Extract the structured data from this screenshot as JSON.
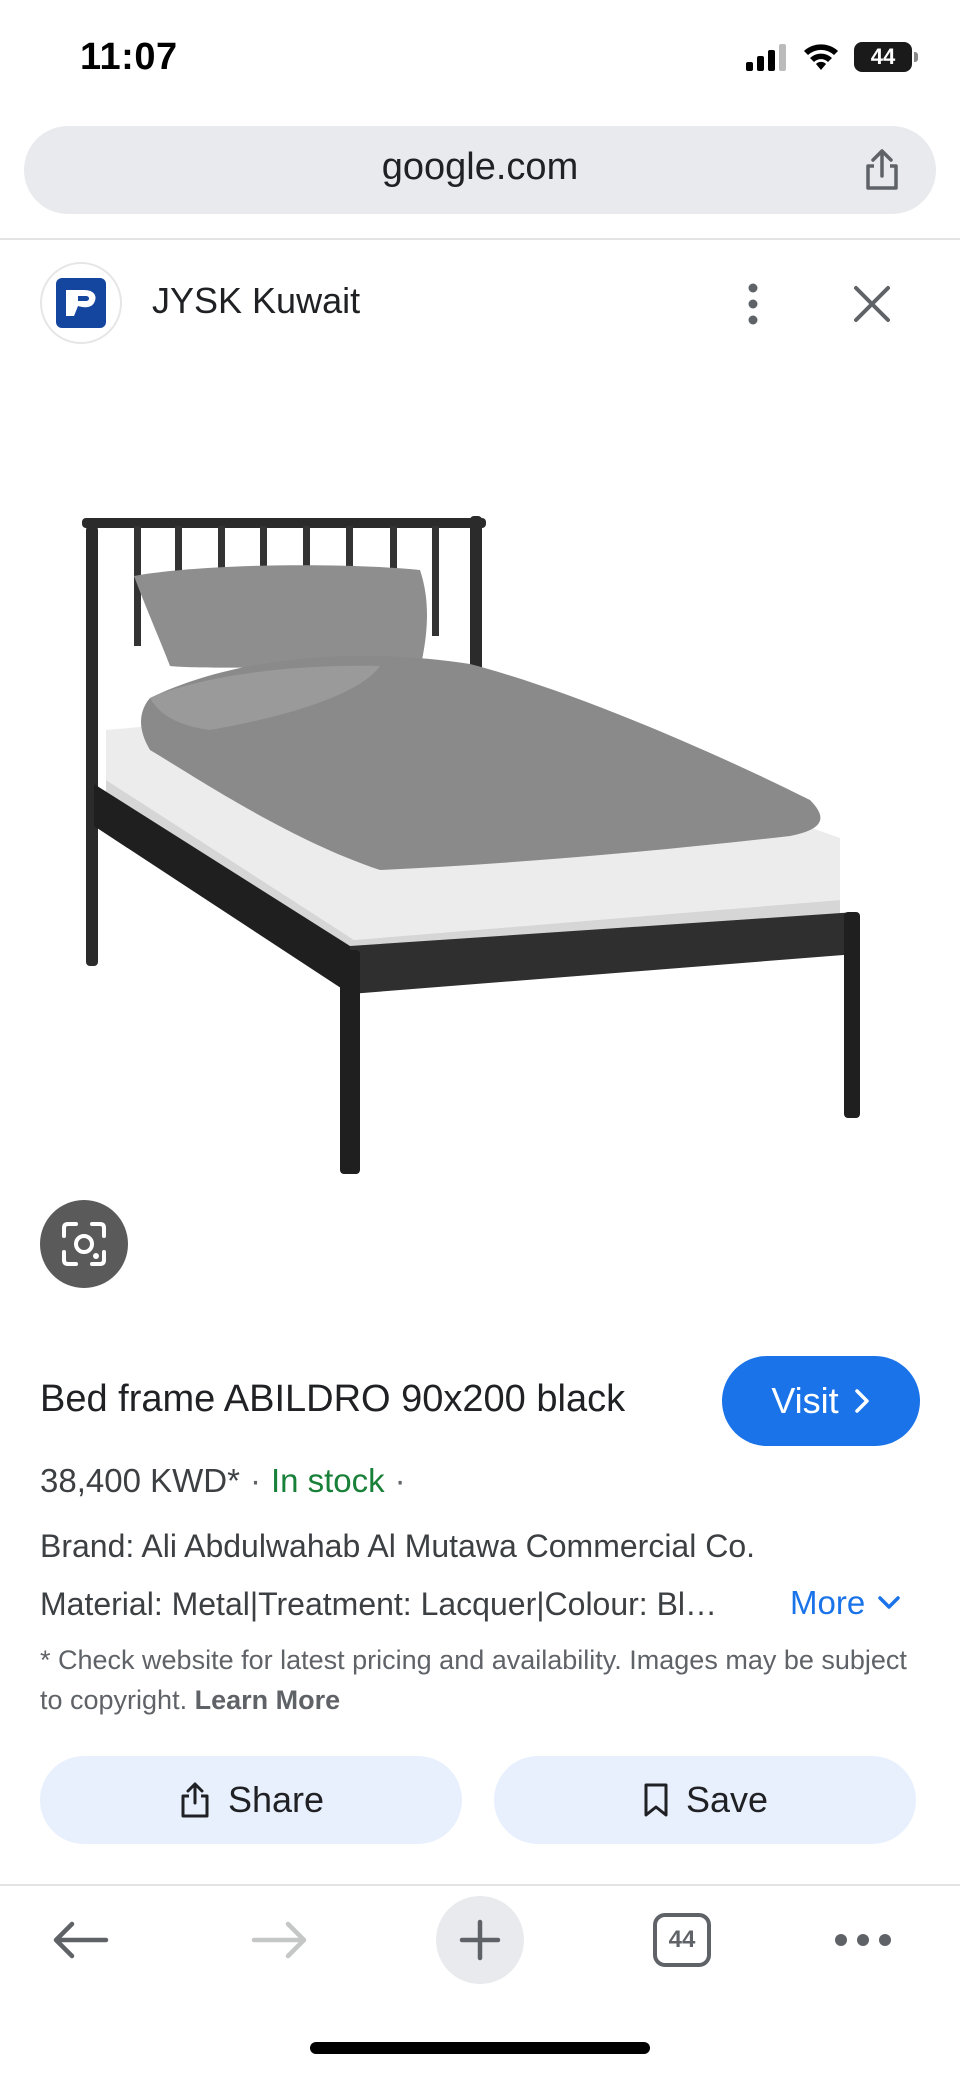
{
  "status_bar": {
    "time": "11:07",
    "battery": "44"
  },
  "browser": {
    "url": "google.com"
  },
  "site": {
    "name": "JYSK Kuwait"
  },
  "product": {
    "title": "Bed frame ABILDRO 90x200 black",
    "visit_label": "Visit",
    "price": "38,400 KWD*",
    "separator": "·",
    "stock": "In stock",
    "brand": "Brand: Ali Abdulwahab Al Mutawa Commercial Co.",
    "material": "Material: Metal|Treatment: Lacquer|Colour: Black",
    "more_label": "More",
    "disclaimer": "* Check website for latest pricing and availability. Images may be subject to copyright.",
    "learn_more": "Learn More"
  },
  "actions": {
    "share_label": "Share",
    "save_label": "Save"
  },
  "toolbar": {
    "tab_count": "44"
  },
  "colors": {
    "accent": "#1a73e8",
    "stock_green": "#188038",
    "chip_bg": "#e8f0fe"
  }
}
